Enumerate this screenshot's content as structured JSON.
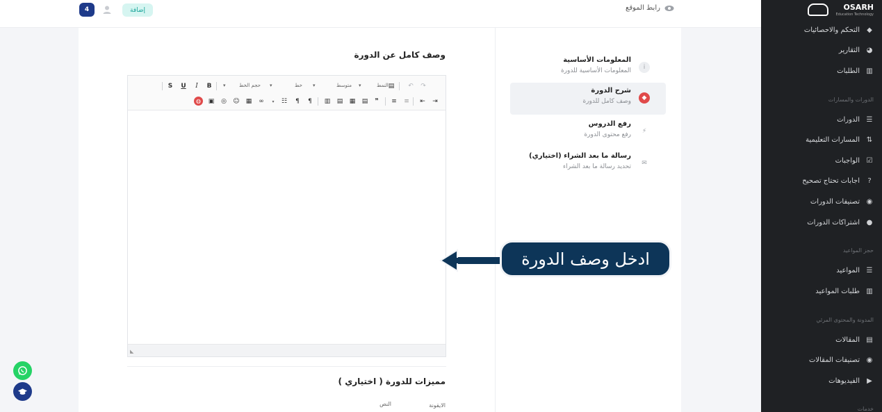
{
  "sidebar": {
    "brand": "OSARH",
    "tagline": "Education Technology",
    "items": [
      {
        "label": "التحكم والاحصائيات",
        "icon": "diamond-icon"
      },
      {
        "label": "التقارير",
        "icon": "pie-chart-icon"
      },
      {
        "label": "الطلبات",
        "icon": "basket-icon"
      },
      {
        "label": "الدورات",
        "icon": "list-icon"
      },
      {
        "label": "المسارات التعليمية",
        "icon": "route-icon"
      },
      {
        "label": "الواجبات",
        "icon": "check-square-icon"
      },
      {
        "label": "اجابات تحتاج تصحيح",
        "icon": "question-icon"
      },
      {
        "label": "تصنيفات الدورات",
        "icon": "eye-icon"
      },
      {
        "label": "اشتراكات الدورات",
        "icon": "user-icon"
      },
      {
        "label": "المواعيد",
        "icon": "list-icon"
      },
      {
        "label": "طلبات المواعيد",
        "icon": "basket-icon"
      },
      {
        "label": "المقالات",
        "icon": "document-icon"
      },
      {
        "label": "تصنيفات المقالات",
        "icon": "eye-icon"
      },
      {
        "label": "الفيديوهات",
        "icon": "play-icon"
      }
    ],
    "sections": [
      "الدورات والمسارات",
      "حجز المواعيد",
      "المدونة والمحتوى المرئي",
      "خدمات"
    ]
  },
  "header": {
    "site_link": "رابط الموقع",
    "add_button": "إضافة",
    "notification_count": "4"
  },
  "steps": [
    {
      "title": "المعلومات الأساسية",
      "desc": "المعلومات الأساسية للدورة",
      "icon": "info-icon"
    },
    {
      "title": "شرح الدورة",
      "desc": "وصف كامل للدورة",
      "icon": "compass-icon"
    },
    {
      "title": "رفع الدروس",
      "desc": "رفع محتوى الدورة",
      "icon": "lightning-icon"
    },
    {
      "title": "رسالة ما بعد الشراء (اختياري)",
      "desc": "تحديد رسالة ما بعد الشراء",
      "icon": "envelope-icon"
    }
  ],
  "content": {
    "section_title": "وصف كامل عن الدورة",
    "features_title": "مميزات للدورة ( اختياري )",
    "label_icon": "الايقونة",
    "label_text": "النص"
  },
  "editor": {
    "toolbar": {
      "bold": "B",
      "italic": "I",
      "underline": "U",
      "strike": "S",
      "format_select": "النمط",
      "size_select": "متوسط",
      "font_select": "خط",
      "size2_select": "حجم الخط"
    }
  },
  "callout": {
    "text": "ادخل وصف الدورة"
  },
  "colors": {
    "sidebar_bg": "#1f2124",
    "callout_bg": "#0d3558",
    "accent_red": "#e04a4a",
    "whatsapp_green": "#25d366",
    "fab_blue": "#1e3a8a"
  }
}
